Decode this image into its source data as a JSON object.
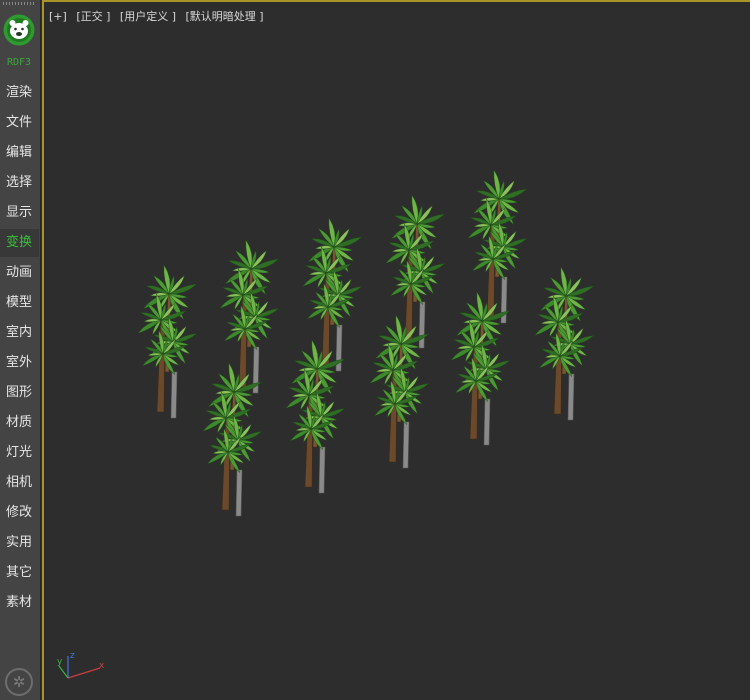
{
  "sidebar": {
    "brand": "RDF3",
    "items": [
      {
        "label": "渲染",
        "active": false
      },
      {
        "label": "文件",
        "active": false
      },
      {
        "label": "编辑",
        "active": false
      },
      {
        "label": "选择",
        "active": false
      },
      {
        "label": "显示",
        "active": false
      },
      {
        "label": "变换",
        "active": true
      },
      {
        "label": "动画",
        "active": false
      },
      {
        "label": "模型",
        "active": false
      },
      {
        "label": "室内",
        "active": false
      },
      {
        "label": "室外",
        "active": false
      },
      {
        "label": "图形",
        "active": false
      },
      {
        "label": "材质",
        "active": false
      },
      {
        "label": "灯光",
        "active": false
      },
      {
        "label": "相机",
        "active": false
      },
      {
        "label": "修改",
        "active": false
      },
      {
        "label": "实用",
        "active": false
      },
      {
        "label": "其它",
        "active": false
      },
      {
        "label": "素材",
        "active": false
      }
    ],
    "settings_icon": "gear-icon"
  },
  "viewport": {
    "label_plus": "[+]",
    "label_view": "[正交 ]",
    "label_mode": "[用户定义 ]",
    "label_shading": "[默认明暗处理 ]",
    "border_color": "#a8952a",
    "axis": {
      "x": "x",
      "y": "y",
      "z": "z"
    }
  },
  "colors": {
    "sidebar_bg": "#444444",
    "viewport_bg": "#2d2d2d",
    "active_text": "#3bbf3b",
    "trunk": "#6b4a2c",
    "leaf": "#3f8f2f"
  }
}
